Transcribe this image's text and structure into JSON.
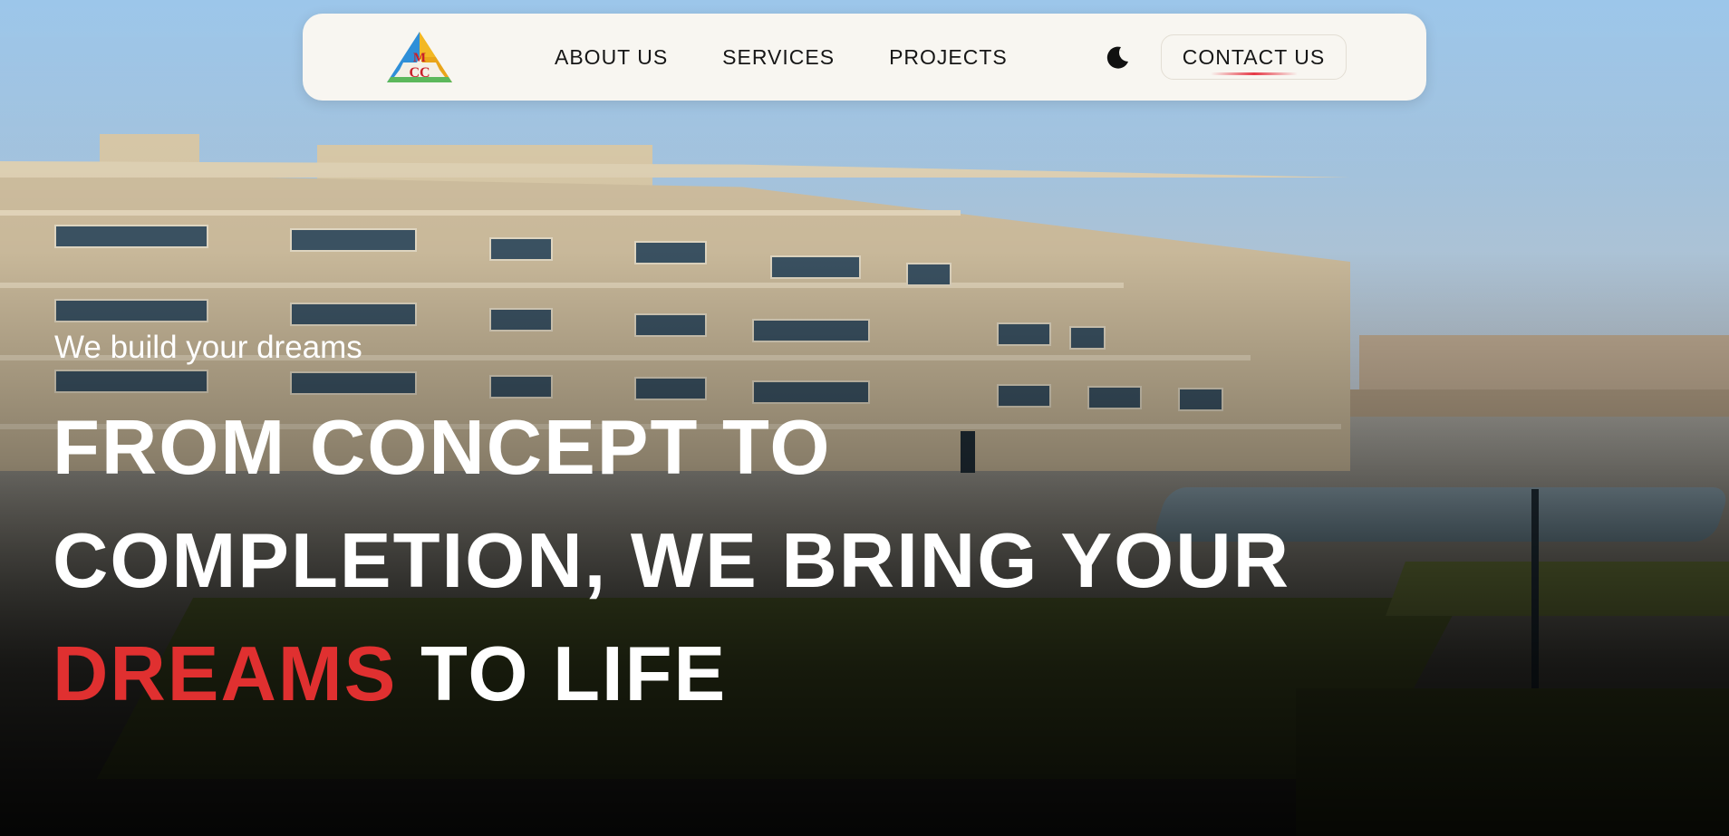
{
  "nav": {
    "logo_text": "MCC",
    "links": [
      {
        "label": "ABOUT US"
      },
      {
        "label": "SERVICES"
      },
      {
        "label": "PROJECTS"
      }
    ],
    "theme_toggle_icon": "moon-icon",
    "contact_label": "CONTACT US"
  },
  "hero": {
    "tagline": "We build your dreams",
    "headline_line1": "FROM CONCEPT TO",
    "headline_line2": "COMPLETION, WE BRING YOUR",
    "headline_highlight": "DREAMS",
    "headline_line3_rest": " TO LIFE"
  },
  "colors": {
    "accent": "#e03030",
    "nav_bg": "#f8f6f1",
    "text_dark": "#161616",
    "text_light": "#ffffff"
  }
}
